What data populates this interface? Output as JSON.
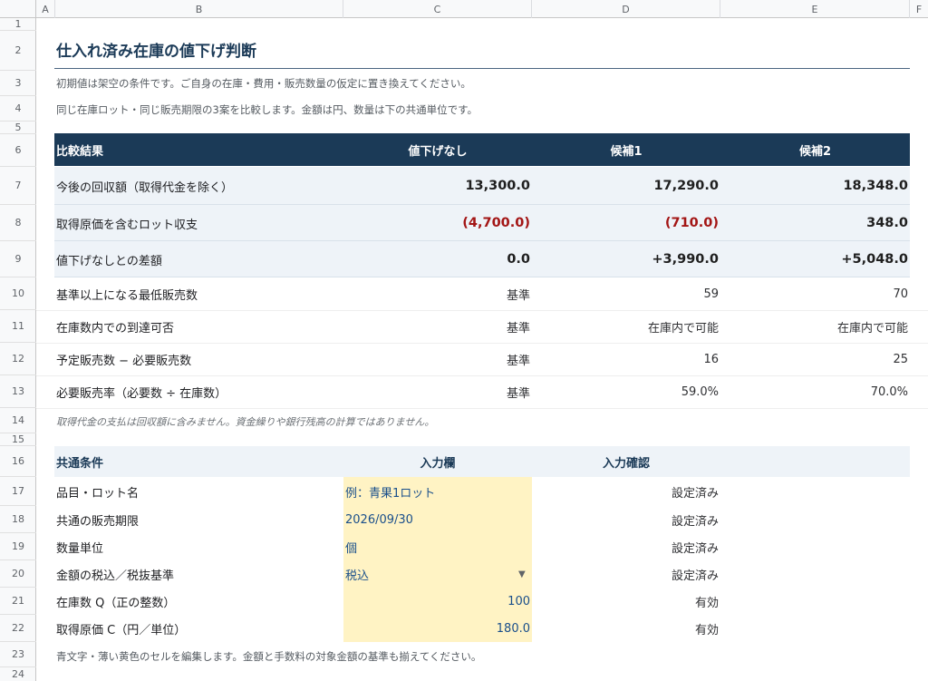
{
  "columns": [
    "A",
    "B",
    "C",
    "D",
    "E",
    "F"
  ],
  "rows": [
    "1",
    "2",
    "3",
    "4",
    "5",
    "6",
    "7",
    "8",
    "9",
    "10",
    "11",
    "12",
    "13",
    "14",
    "15",
    "16",
    "17",
    "18",
    "19",
    "20",
    "21",
    "22",
    "23",
    "24"
  ],
  "title": "仕入れ済み在庫の値下げ判断",
  "notes": {
    "line3": "初期値は架空の条件です。ご自身の在庫・費用・販売数量の仮定に置き換えてください。",
    "line4": "同じ在庫ロット・同じ販売期限の3案を比較します。金額は円、数量は下の共通単位です。",
    "line14": "取得代金の支払は回収額に含みません。資金繰りや銀行残高の計算ではありません。",
    "line23": "青文字・薄い黄色のセルを編集します。金額と手数料の対象金額の基準も揃えてください。"
  },
  "results": {
    "header": [
      "比較結果",
      "値下げなし",
      "候補1",
      "候補2"
    ],
    "rows": [
      {
        "label": "今後の回収額（取得代金を除く）",
        "values": [
          "13,300.0",
          "17,290.0",
          "18,348.0"
        ]
      },
      {
        "label": "取得原価を含むロット収支",
        "values": [
          "(4,700.0)",
          "(710.0)",
          "348.0"
        ]
      },
      {
        "label": "値下げなしとの差額",
        "values": [
          "0.0",
          "+3,990.0",
          "+5,048.0"
        ]
      },
      {
        "label": "基準以上になる最低販売数",
        "values": [
          "基準",
          "59",
          "70"
        ]
      },
      {
        "label": "在庫数内での到達可否",
        "values": [
          "基準",
          "在庫内で可能",
          "在庫内で可能"
        ]
      },
      {
        "label": "予定販売数 − 必要販売数",
        "values": [
          "基準",
          "16",
          "25"
        ]
      },
      {
        "label": "必要販売率（必要数 ÷ 在庫数）",
        "values": [
          "基準",
          "59.0%",
          "70.0%"
        ]
      }
    ]
  },
  "conditions": {
    "header": [
      "共通条件",
      "入力欄",
      "入力確認"
    ],
    "rows": [
      {
        "label": "品目・ロット名",
        "value": "例：青果1ロット",
        "status": "設定済み"
      },
      {
        "label": "共通の販売期限",
        "value": "2026/09/30",
        "status": "設定済み"
      },
      {
        "label": "数量単位",
        "value": "個",
        "status": "設定済み"
      },
      {
        "label": "金額の税込／税抜基準",
        "value": "税込",
        "status": "設定済み"
      },
      {
        "label": "在庫数 Q（正の整数）",
        "value": "100",
        "status": "有効"
      },
      {
        "label": "取得原価 C（円／単位）",
        "value": "180.0",
        "status": "有効"
      }
    ]
  },
  "icons": {
    "dropdown": "dropdown-triangle-icon"
  },
  "colors": {
    "header_bg": "#1b3a57",
    "negative": "#a31515",
    "input_bg": "#fff3c4",
    "input_text": "#1a4f8b",
    "band": "#eef3f8"
  }
}
